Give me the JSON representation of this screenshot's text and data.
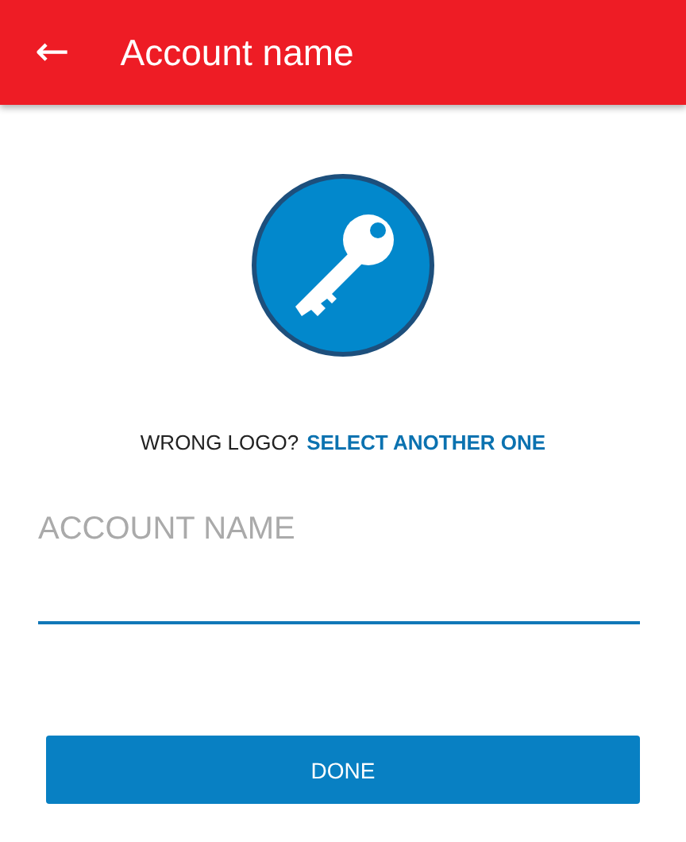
{
  "app_bar": {
    "back_icon": "←",
    "title": "Account name"
  },
  "logo_prompt": {
    "question": "WRONG LOGO?",
    "link": "SELECT ANOTHER ONE"
  },
  "account_field": {
    "placeholder": "ACCOUNT NAME"
  },
  "buttons": [
    "DONE"
  ]
}
